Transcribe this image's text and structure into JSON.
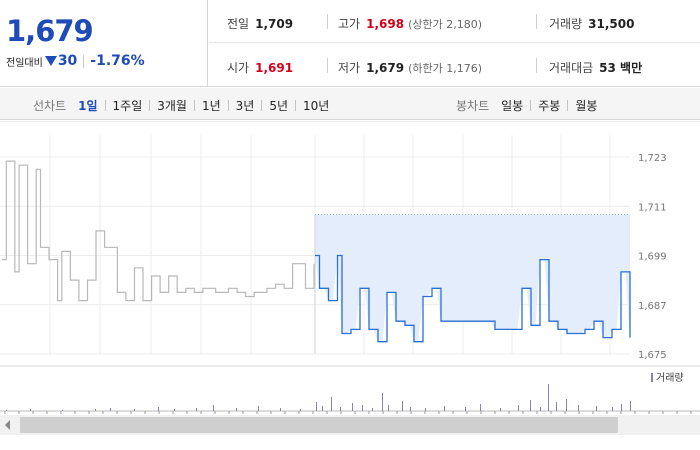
{
  "summary": {
    "price": "1,679",
    "change_label": "전일대비",
    "change_value": "30",
    "change_percent": "-1.76%"
  },
  "stats": {
    "prev_close": {
      "label": "전일",
      "value": "1,709"
    },
    "high": {
      "label": "고가",
      "value": "1,698",
      "sub": "(상한가 2,180)"
    },
    "volume": {
      "label": "거래량",
      "value": "31,500"
    },
    "open": {
      "label": "시가",
      "value": "1,691"
    },
    "low": {
      "label": "저가",
      "value": "1,679",
      "sub": "(하한가 1,176)"
    },
    "trade_amount": {
      "label": "거래대금",
      "value": "53 백만"
    }
  },
  "line_tabs": {
    "title": "선차트",
    "items": [
      "1일",
      "1주일",
      "3개월",
      "1년",
      "3년",
      "5년",
      "10년"
    ],
    "active": "1일"
  },
  "candle_tabs": {
    "title": "봉차트",
    "items": [
      "일봉",
      "주봉",
      "월봉"
    ]
  },
  "colors": {
    "accent": "#1e4bb8",
    "up": "#d0021b",
    "today_line": "#2a6fd6",
    "today_fill": "#e4edfb",
    "prev_line": "#b8b8b8",
    "volume_bar": "#8a7fc2"
  },
  "chart_data": {
    "type": "line",
    "y_ticks": [
      "1,723",
      "1,711",
      "1,699",
      "1,687",
      "1,675"
    ],
    "ylim": [
      1675,
      1723
    ],
    "prev_close_line": 1709,
    "volume_legend": "거래량",
    "series": [
      {
        "values": [
          1698,
          1722,
          1722,
          1695,
          1721,
          1721,
          1697,
          1697,
          1720,
          1701,
          1701,
          1698,
          1698,
          1688,
          1700,
          1700,
          1693,
          1693,
          1688,
          1688,
          1693,
          1693,
          1705,
          1705,
          1701,
          1701,
          1701,
          1690,
          1690,
          1688,
          1688,
          1696,
          1696,
          1688,
          1688,
          1694,
          1694,
          1690,
          1690,
          1694,
          1694,
          1690,
          1690,
          1691,
          1691,
          1690,
          1690,
          1691,
          1691,
          1691,
          1690,
          1690,
          1690,
          1691,
          1691,
          1690,
          1690,
          1689,
          1689,
          1690,
          1690,
          1690,
          1691,
          1691,
          1692,
          1692,
          1691,
          1691,
          1697,
          1697,
          1697,
          1691,
          1691,
          1697
        ]
      },
      {
        "values": [
          1699,
          1691,
          1691,
          1688,
          1688,
          1699,
          1680,
          1680,
          1681,
          1681,
          1691,
          1691,
          1681,
          1681,
          1678,
          1678,
          1690,
          1690,
          1683,
          1683,
          1682,
          1682,
          1678,
          1678,
          1689,
          1689,
          1691,
          1691,
          1683,
          1683,
          1683,
          1683,
          1683,
          1683,
          1683,
          1683,
          1683,
          1683,
          1683,
          1683,
          1681,
          1681,
          1681,
          1681,
          1681,
          1681,
          1691,
          1691,
          1682,
          1682,
          1698,
          1698,
          1683,
          1683,
          1681,
          1681,
          1680,
          1680,
          1680,
          1680,
          1681,
          1681,
          1683,
          1683,
          1679,
          1679,
          1681,
          1681,
          1695,
          1695,
          1679
        ]
      }
    ]
  }
}
